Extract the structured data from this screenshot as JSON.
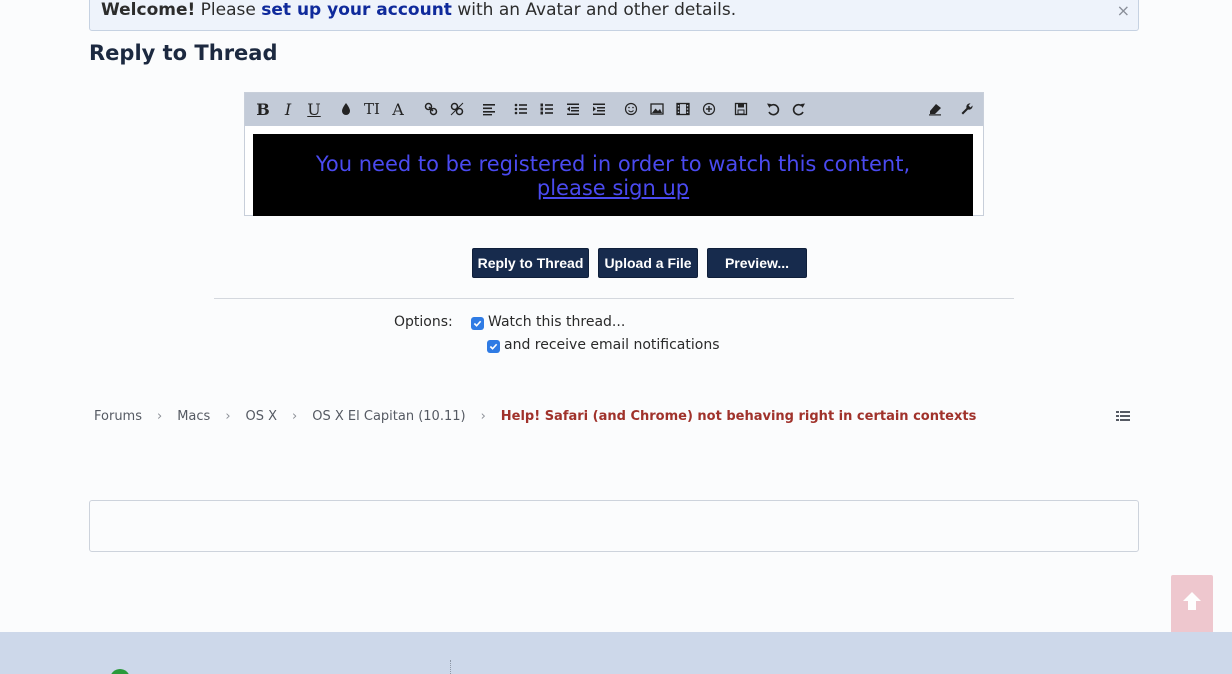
{
  "notice": {
    "welcome": "Welcome!",
    "please": "Please",
    "link": "set up your account",
    "rest": "with an Avatar and other details.",
    "close": "×"
  },
  "page_title": "Reply to Thread",
  "editor": {
    "toolbar": {
      "bold": "B",
      "italic": "I",
      "underline": "U",
      "text_size": "TI",
      "font": "A"
    },
    "content": {
      "message": "You need to be registered in order to watch this content,",
      "link": "please sign up"
    }
  },
  "buttons": {
    "reply": "Reply to Thread",
    "upload": "Upload a File",
    "preview": "Preview..."
  },
  "options": {
    "label": "Options:",
    "watch": "Watch this thread...",
    "email": "and receive email notifications"
  },
  "breadcrumb": {
    "items": [
      "Forums",
      "Macs",
      "OS X",
      "OS X El Capitan (10.11)"
    ],
    "current": "Help! Safari (and Chrome) not behaving right in certain contexts",
    "separator": "›"
  },
  "colors": {
    "accent": "#172b4d",
    "link": "#0f2a9b",
    "current_crumb": "#a0322b",
    "checkbox": "#2f7be4"
  }
}
